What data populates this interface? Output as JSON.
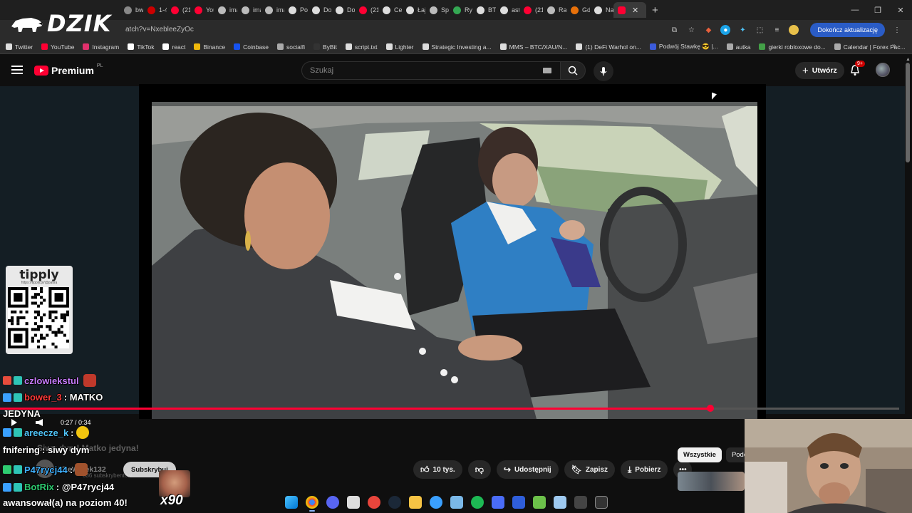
{
  "overlay": {
    "logo_text": "DZIK",
    "tipply_brand": "tipply",
    "tipply_link": "https://tipply.pl/@patira",
    "x90_label": "x90"
  },
  "browser": {
    "url_fragment": "atch?v=NxebleeZyOc",
    "update_button": "Dokończ aktualizację",
    "tabs": [
      {
        "label": "bw",
        "color": "#888888"
      },
      {
        "label": "1-4",
        "color": "#cc0000"
      },
      {
        "label": "(21",
        "color": "#ff0033"
      },
      {
        "label": "You",
        "color": "#ff0033"
      },
      {
        "label": "ima",
        "color": "#bbbbbb"
      },
      {
        "label": "ima",
        "color": "#bbbbbb"
      },
      {
        "label": "ima",
        "color": "#bbbbbb"
      },
      {
        "label": "Poli",
        "color": "#dddddd"
      },
      {
        "label": "Dor",
        "color": "#dddddd"
      },
      {
        "label": "Dor",
        "color": "#dddddd"
      },
      {
        "label": "(21",
        "color": "#ff0033"
      },
      {
        "label": "Cer",
        "color": "#dddddd"
      },
      {
        "label": "Łaj",
        "color": "#dddddd"
      },
      {
        "label": "Spc",
        "color": "#bbbbbb"
      },
      {
        "label": "Ryb",
        "color": "#34a853"
      },
      {
        "label": "BTC",
        "color": "#dddddd"
      },
      {
        "label": "astr",
        "color": "#dddddd"
      },
      {
        "label": "(21",
        "color": "#ff0033"
      },
      {
        "label": "Rar",
        "color": "#bbbbbb"
      },
      {
        "label": "Gdz",
        "color": "#e8710a"
      },
      {
        "label": "Naj",
        "color": "#dddddd"
      }
    ],
    "bookmarks": [
      {
        "label": "Twitter",
        "color": "#dddddd"
      },
      {
        "label": "YouTube",
        "color": "#ff0033"
      },
      {
        "label": "Instagram",
        "color": "#e1306c"
      },
      {
        "label": "TikTok",
        "color": "#ffffff"
      },
      {
        "label": "react",
        "color": "#ffffff"
      },
      {
        "label": "Binance",
        "color": "#f0b90b"
      },
      {
        "label": "Coinbase",
        "color": "#1652f0"
      },
      {
        "label": "socialfi",
        "color": "#aaaaaa"
      },
      {
        "label": "ByBit",
        "color": "#333333"
      },
      {
        "label": "script.txt",
        "color": "#dddddd"
      },
      {
        "label": "Lighter",
        "color": "#dddddd"
      },
      {
        "label": "Strategic Investing a...",
        "color": "#dddddd"
      },
      {
        "label": "MMS – BTC/XAU/N...",
        "color": "#dddddd"
      },
      {
        "label": "(1) DeFi Warhol on...",
        "color": "#dddddd"
      },
      {
        "label": "Podwój Stawkę 😎 |...",
        "color": "#3b5bdb"
      },
      {
        "label": "autka",
        "color": "#aaaaaa"
      },
      {
        "label": "gierki robloxowe do...",
        "color": "#43a047"
      },
      {
        "label": "Calendar | Forex Fac...",
        "color": "#aaaaaa"
      }
    ]
  },
  "youtube": {
    "brand": "Premium",
    "region": "PL",
    "search_placeholder": "Szukaj",
    "create_label": "Utwórz",
    "notif_badge": "9+"
  },
  "player": {
    "time": "0:27 / 0:34",
    "progress": 0.79
  },
  "below": {
    "title_ghost": "Siwy dym! Matko jedyna!",
    "channel_name": "TheWatek132",
    "channel_subs": "636 subskrybentów",
    "subscribe": "Subskrybuj",
    "likes": "10 tys.",
    "share": "Udostępnij",
    "save": "Zapisz",
    "download": "Pobierz",
    "chips": [
      "Wszystkie",
      "Podo"
    ]
  },
  "chat": [
    {
      "user": "czlowiekstul",
      "text": "",
      "color": "#c77dff",
      "badge": "#e74c3c"
    },
    {
      "user": "bower_3",
      "text": ": MATKO",
      "color": "#ff3b3b",
      "badge": "#3aa0ff"
    },
    {
      "user": "",
      "text": "JEDYNA",
      "color": "#ffffff",
      "badge": ""
    },
    {
      "user": "areecze_k",
      "text": ":",
      "color": "#4fc3f7",
      "badge": "#3aa0ff"
    },
    {
      "user": "fnifering",
      "text": ": siwy dym",
      "color": "#ffffff",
      "badge": ""
    },
    {
      "user": "P47rycj44",
      "text": ":",
      "color": "#3fb0ff",
      "badge": "#2ecc71"
    },
    {
      "user": "BotRix",
      "text": ": @P47rycj44",
      "color": "#2ecc71",
      "badge": "#3aa0ff"
    },
    {
      "user": "",
      "text": "awansował(a) na poziom 40!",
      "color": "#ffffff",
      "badge": ""
    }
  ]
}
